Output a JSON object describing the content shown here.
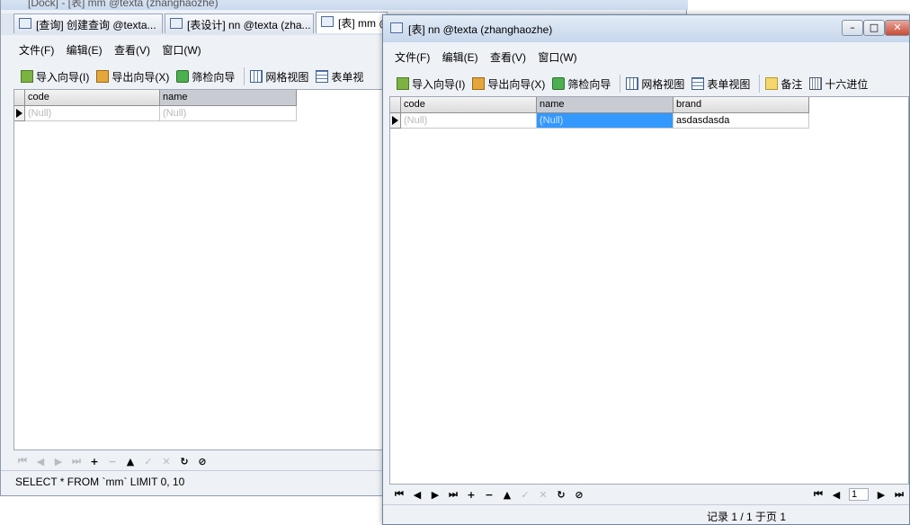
{
  "back": {
    "title": "[Dock] - [表] mm @texta (zhanghaozhe)",
    "tabs": [
      {
        "label": "[查询] 创建查询 @texta..."
      },
      {
        "label": "[表设计] nn @texta (zha..."
      },
      {
        "label": "[表] mm @"
      }
    ],
    "menu": [
      "文件(F)",
      "编辑(E)",
      "查看(V)",
      "窗口(W)"
    ],
    "toolbar": {
      "import": "导入向导(I)",
      "export": "导出向导(X)",
      "filter": "筛检向导",
      "grid": "网格视图",
      "form": "表单视"
    },
    "columns": [
      "code",
      "name"
    ],
    "rows": [
      [
        "(Null)",
        "(Null)"
      ]
    ],
    "status": "SELECT * FROM `mm` LIMIT 0, 10"
  },
  "front": {
    "title": "[表] nn @texta (zhanghaozhe)",
    "window_buttons": {
      "minimize": "–",
      "maximize": "□",
      "close": "✕"
    },
    "menu": [
      "文件(F)",
      "编辑(E)",
      "查看(V)",
      "窗口(W)"
    ],
    "toolbar": {
      "import": "导入向导(I)",
      "export": "导出向导(X)",
      "filter": "筛检向导",
      "grid": "网格视图",
      "form": "表单视图",
      "memo": "备注",
      "hex": "十六进位"
    },
    "columns": [
      "code",
      "name",
      "brand"
    ],
    "rows": [
      [
        "(Null)",
        "(Null)",
        "asdasdasda"
      ]
    ],
    "page_value": "1",
    "status": "记录 1 / 1 于页 1"
  },
  "nav_glyphs": {
    "first": "⏮",
    "prev": "◀",
    "next": "▶",
    "last": "⏭",
    "add": "+",
    "delete": "−",
    "up": "▲",
    "check": "✓",
    "cancel": "✕",
    "refresh": "↻",
    "stop": "⊘",
    "page_first": "⏮",
    "page_prev": "◀",
    "page_next": "▶",
    "page_last": "⏭"
  },
  "colors": {
    "selected_cell": "#3399ff",
    "null_text": "#b9b9b9",
    "window_bg": "#eef1f6"
  }
}
